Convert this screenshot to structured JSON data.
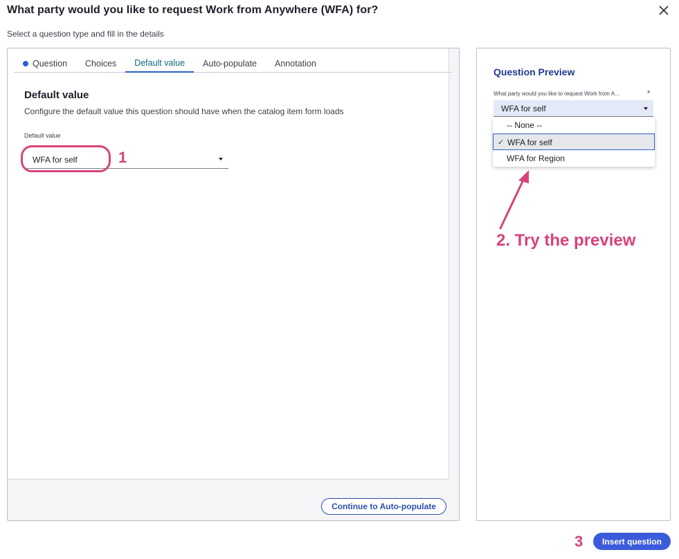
{
  "dialog": {
    "title": "What party would you like to request Work from Anywhere (WFA) for?",
    "subtitle": "Select a question type and fill in the details"
  },
  "tabs": [
    {
      "label": "Question",
      "active": false,
      "has_dot": true
    },
    {
      "label": "Choices",
      "active": false
    },
    {
      "label": "Default value",
      "active": true
    },
    {
      "label": "Auto-populate",
      "active": false
    },
    {
      "label": "Annotation",
      "active": false
    }
  ],
  "default_value_section": {
    "title": "Default value",
    "description": "Configure the default value this question should have when the catalog item form loads",
    "field_label": "Default value",
    "field_value": "WFA for self"
  },
  "continue_button": "Continue to Auto-populate",
  "preview": {
    "title": "Question Preview",
    "question_label": "What party would you like to request Work from A...",
    "required_mark": "*",
    "selected_value": "WFA for self",
    "options": [
      {
        "label": "-- None --",
        "selected": false
      },
      {
        "label": "WFA for self",
        "selected": true
      },
      {
        "label": "WFA for Region",
        "selected": false
      }
    ]
  },
  "annotations": {
    "step1": "1",
    "step2": "2. Try the preview",
    "step3": "3"
  },
  "insert_button": "Insert question",
  "colors": {
    "accent": "#3b5bdb",
    "annotation": "#d6437a",
    "preview_title": "#1d3a8f",
    "active_tab_text": "#0b6b7a"
  },
  "icons": {
    "close": "close-icon",
    "check": "checkmark-icon",
    "caret": "chevron-down-icon"
  }
}
